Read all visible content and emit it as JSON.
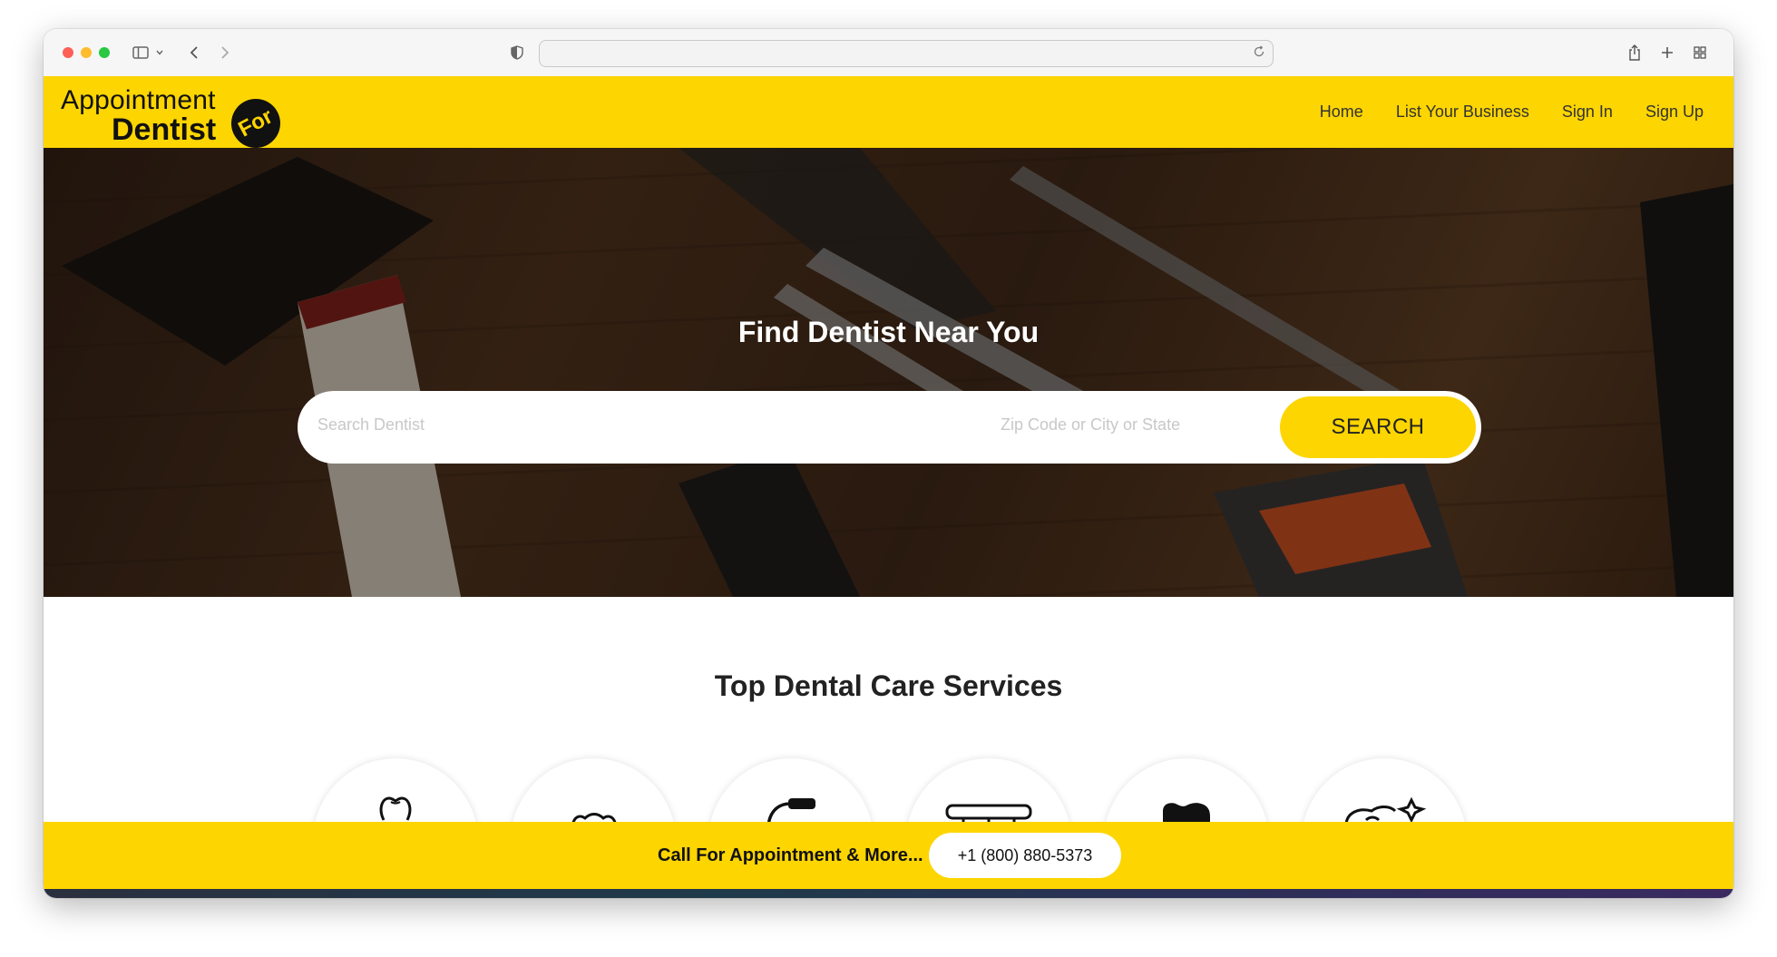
{
  "colors": {
    "brand_yellow": "#fdd500",
    "text_dark": "#222222",
    "hero_text": "#ffffff"
  },
  "browser": {
    "address_value": "",
    "icons": [
      "sidebar-icon",
      "chevron-down-icon",
      "back-icon",
      "forward-icon",
      "shield-icon",
      "reload-icon",
      "share-icon",
      "new-tab-icon",
      "tab-overview-icon"
    ]
  },
  "header": {
    "logo": {
      "line1": "Appointment",
      "line2": "Dentist",
      "badge": "For"
    },
    "nav": [
      {
        "label": "Home"
      },
      {
        "label": "List Your Business"
      },
      {
        "label": "Sign In"
      },
      {
        "label": "Sign Up"
      }
    ]
  },
  "hero": {
    "title": "Find Dentist Near You",
    "search_placeholder": "Search Dentist",
    "location_placeholder": "Zip Code or City or State",
    "search_button": "SEARCH"
  },
  "services": {
    "title": "Top Dental Care Services",
    "icons": [
      "tooth-icon",
      "dentures-icon",
      "dental-drill-icon",
      "dental-bridge-icon",
      "molar-icon",
      "tooth-sparkle-icon"
    ]
  },
  "bottom_bar": {
    "call_text": "Call For Appointment & More...",
    "phone": "+1 (800) 880-5373"
  }
}
